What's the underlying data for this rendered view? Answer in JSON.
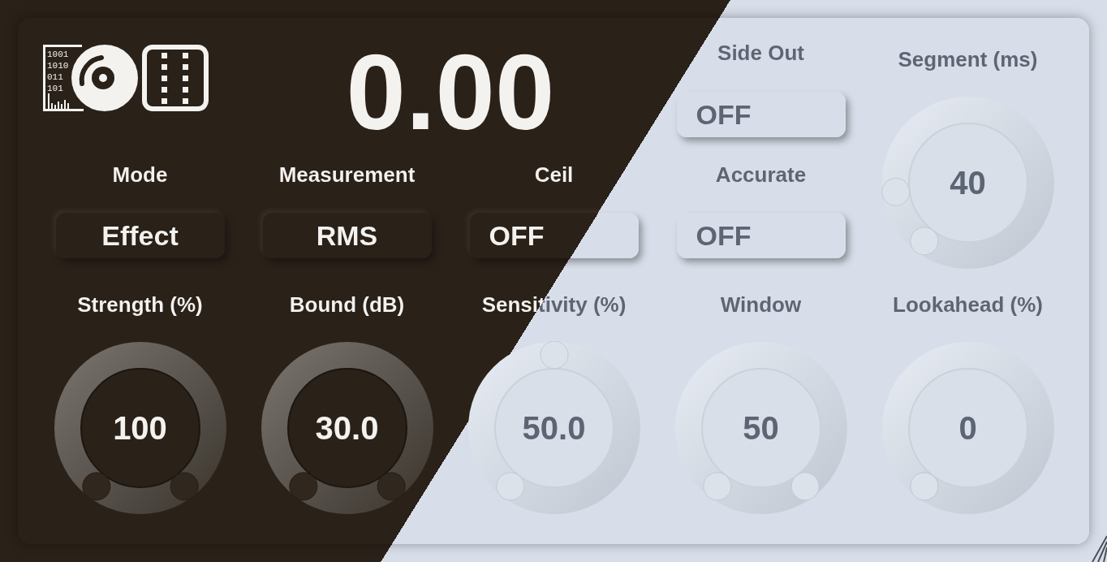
{
  "logo": {
    "digits": [
      "1001",
      "1010",
      "011",
      "101"
    ]
  },
  "readout": "0.00",
  "side_out": {
    "label": "Side Out",
    "value": "OFF",
    "kind": "toggle"
  },
  "segment": {
    "label": "Segment (ms)",
    "value": "40"
  },
  "selectors": [
    {
      "label": "Mode",
      "value": "Effect",
      "kind": "menu"
    },
    {
      "label": "Measurement",
      "value": "RMS",
      "kind": "menu"
    },
    {
      "label": "Ceil",
      "value": "OFF",
      "kind": "toggle"
    },
    {
      "label": "Accurate",
      "value": "OFF",
      "kind": "toggle"
    }
  ],
  "knobs": [
    {
      "label": "Strength (%)",
      "value": "100"
    },
    {
      "label": "Bound (dB)",
      "value": "30.0"
    },
    {
      "label": "Sensitivity (%)",
      "value": "50.0"
    },
    {
      "label": "Window",
      "value": "50"
    },
    {
      "label": "Lookahead (%)",
      "value": "0"
    }
  ]
}
